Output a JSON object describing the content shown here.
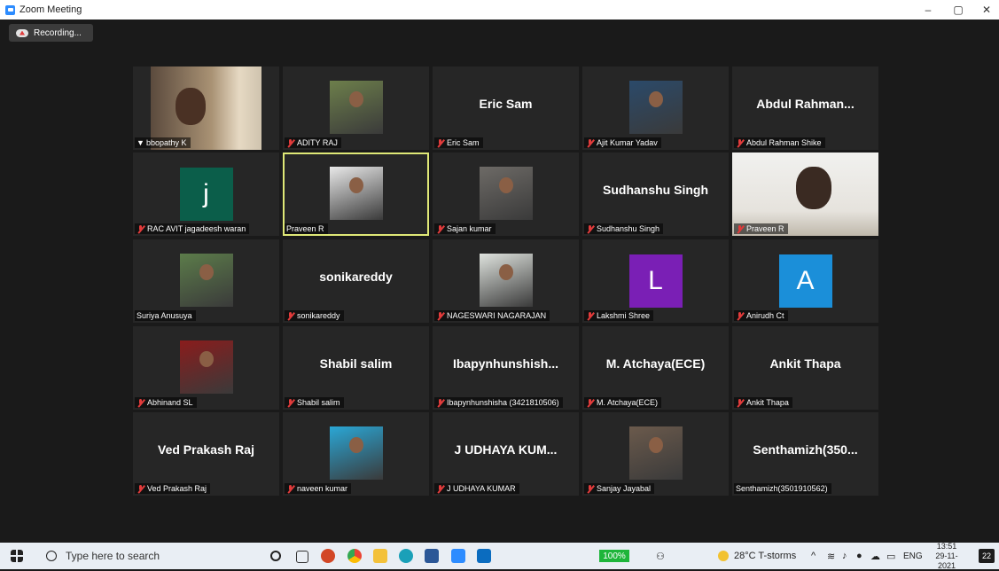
{
  "window": {
    "title": "Zoom Meeting",
    "minimize": "–",
    "maximize": "▢",
    "close": "✕"
  },
  "recording": {
    "label": "Recording..."
  },
  "tiles": [
    {
      "name": "bbopathy K",
      "big": "",
      "muted": false,
      "pinned": true,
      "kind": "video1"
    },
    {
      "name": "ADITY RAJ",
      "big": "",
      "muted": true,
      "kind": "photo",
      "color": "#6d7f4b"
    },
    {
      "name": "Eric Sam",
      "big": "Eric Sam",
      "muted": true,
      "kind": "text"
    },
    {
      "name": "Ajit Kumar Yadav",
      "big": "",
      "muted": true,
      "kind": "photo",
      "color": "#2b4a6a"
    },
    {
      "name": "Abdul Rahman Shike",
      "big": "Abdul  Rahman...",
      "muted": true,
      "kind": "text"
    },
    {
      "name": "RAC AVIT jagadeesh waran",
      "big": "j",
      "muted": true,
      "kind": "letter",
      "color": "#0b5e4a"
    },
    {
      "name": "Praveen R",
      "big": "",
      "muted": false,
      "kind": "photo",
      "color": "#e9e9e9",
      "active": true
    },
    {
      "name": "Sajan kumar",
      "big": "",
      "muted": true,
      "kind": "photo",
      "color": "#6d6a66"
    },
    {
      "name": "Sudhanshu Singh",
      "big": "Sudhanshu Singh",
      "muted": true,
      "kind": "text"
    },
    {
      "name": "Praveen R",
      "big": "",
      "muted": true,
      "kind": "video2"
    },
    {
      "name": "Suriya Anusuya",
      "big": "",
      "muted": false,
      "kind": "photo",
      "color": "#5c7c4a"
    },
    {
      "name": "sonikareddy",
      "big": "sonikareddy",
      "muted": true,
      "kind": "text"
    },
    {
      "name": "NAGESWARI NAGARAJAN",
      "big": "",
      "muted": true,
      "kind": "photo",
      "color": "#dfe3de"
    },
    {
      "name": "Lakshmi Shree",
      "big": "L",
      "muted": true,
      "kind": "letter",
      "color": "#7a1fb5"
    },
    {
      "name": "Anirudh Ct",
      "big": "A",
      "muted": true,
      "kind": "letter",
      "color": "#1b8fd9"
    },
    {
      "name": "Abhinand SL",
      "big": "",
      "muted": true,
      "kind": "photo",
      "color": "#8a1c1c"
    },
    {
      "name": "Shabil salim",
      "big": "Shabil salim",
      "muted": true,
      "kind": "text"
    },
    {
      "name": "Ibapynhunshisha (3421810506)",
      "big": "Ibapynhunshish...",
      "muted": true,
      "kind": "text"
    },
    {
      "name": "M. Atchaya(ECE)",
      "big": "M. Atchaya(ECE)",
      "muted": true,
      "kind": "text"
    },
    {
      "name": "Ankit Thapa",
      "big": "Ankit Thapa",
      "muted": true,
      "kind": "text"
    },
    {
      "name": "Ved Prakash Raj",
      "big": "Ved Prakash Raj",
      "muted": true,
      "kind": "text"
    },
    {
      "name": "naveen kumar",
      "big": "",
      "muted": true,
      "kind": "photo",
      "color": "#2aa7d6"
    },
    {
      "name": "J UDHAYA KUMAR",
      "big": "J UDHAYA KUM...",
      "muted": true,
      "kind": "text"
    },
    {
      "name": "Sanjay Jayabal",
      "big": "",
      "muted": true,
      "kind": "photo",
      "color": "#6b5a4c"
    },
    {
      "name": "Senthamizh(3501910562)",
      "big": "Senthamizh(350...",
      "muted": false,
      "kind": "text"
    }
  ],
  "taskbar": {
    "search_placeholder": "Type here to search",
    "battery_pct": "100%",
    "weather": "28°C  T-storms",
    "language": "ENG",
    "time": "13:51",
    "date": "29-11-2021",
    "notifications": "22"
  }
}
